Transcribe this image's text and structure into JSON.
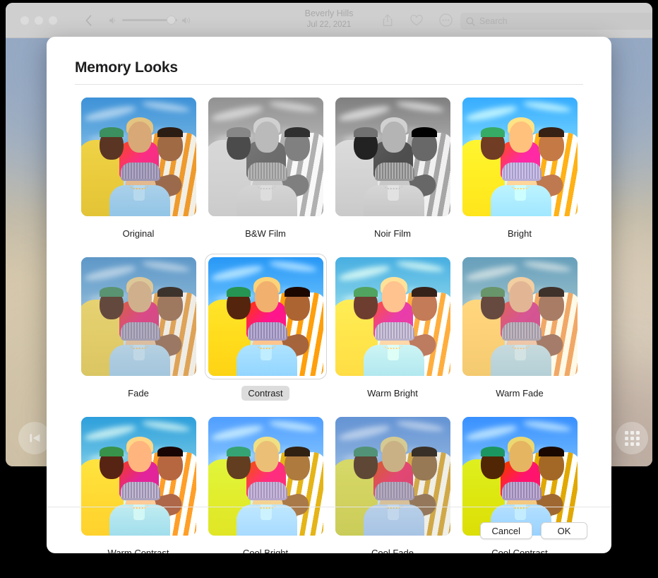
{
  "window": {
    "toolbar": {
      "traffic_lights": [
        "close",
        "minimize",
        "zoom"
      ],
      "back_label": "Back",
      "volume_low_icon": "speaker-low-icon",
      "volume_high_icon": "speaker-high-icon",
      "volume_value": "80",
      "title": "Beverly Hills",
      "subtitle": "Jul 22, 2021",
      "share_icon": "share-icon",
      "favorite_icon": "heart-icon",
      "more_icon": "ellipsis-circle-icon",
      "search": {
        "icon": "search-icon",
        "placeholder": "Search",
        "value": ""
      }
    },
    "overlay": {
      "previous_label": "Previous",
      "previous_icon": "skip-back-icon",
      "grid_label": "Grid",
      "grid_icon": "grid-icon"
    }
  },
  "sheet": {
    "title": "Memory Looks",
    "selected_look": "Contrast",
    "looks": [
      {
        "label": "Original",
        "filter": "f-original"
      },
      {
        "label": "B&W Film",
        "filter": "f-bwfilm"
      },
      {
        "label": "Noir Film",
        "filter": "f-noirfilm"
      },
      {
        "label": "Bright",
        "filter": "f-bright"
      },
      {
        "label": "Fade",
        "filter": "f-fade"
      },
      {
        "label": "Contrast",
        "filter": "f-contrast"
      },
      {
        "label": "Warm Bright",
        "filter": "f-warmbright"
      },
      {
        "label": "Warm Fade",
        "filter": "f-warmfade"
      },
      {
        "label": "Warm Contrast",
        "filter": "f-warmcontr"
      },
      {
        "label": "Cool Bright",
        "filter": "f-coolbright"
      },
      {
        "label": "Cool Fade",
        "filter": "f-coolfade"
      },
      {
        "label": "Cool Contrast",
        "filter": "f-coolcontr"
      }
    ],
    "actions": {
      "cancel_label": "Cancel",
      "ok_label": "OK"
    }
  },
  "colors": {
    "toolbar_bg": "#cfcfcf",
    "sheet_bg": "#ffffff",
    "selected_pill": "#dcdcdc",
    "selection_ring": "#d4d4d4",
    "text_primary": "#1d1d1f",
    "toolbar_text": "#a9a9a9",
    "divider": "#e3e3e3",
    "page_bg": "#000000"
  }
}
